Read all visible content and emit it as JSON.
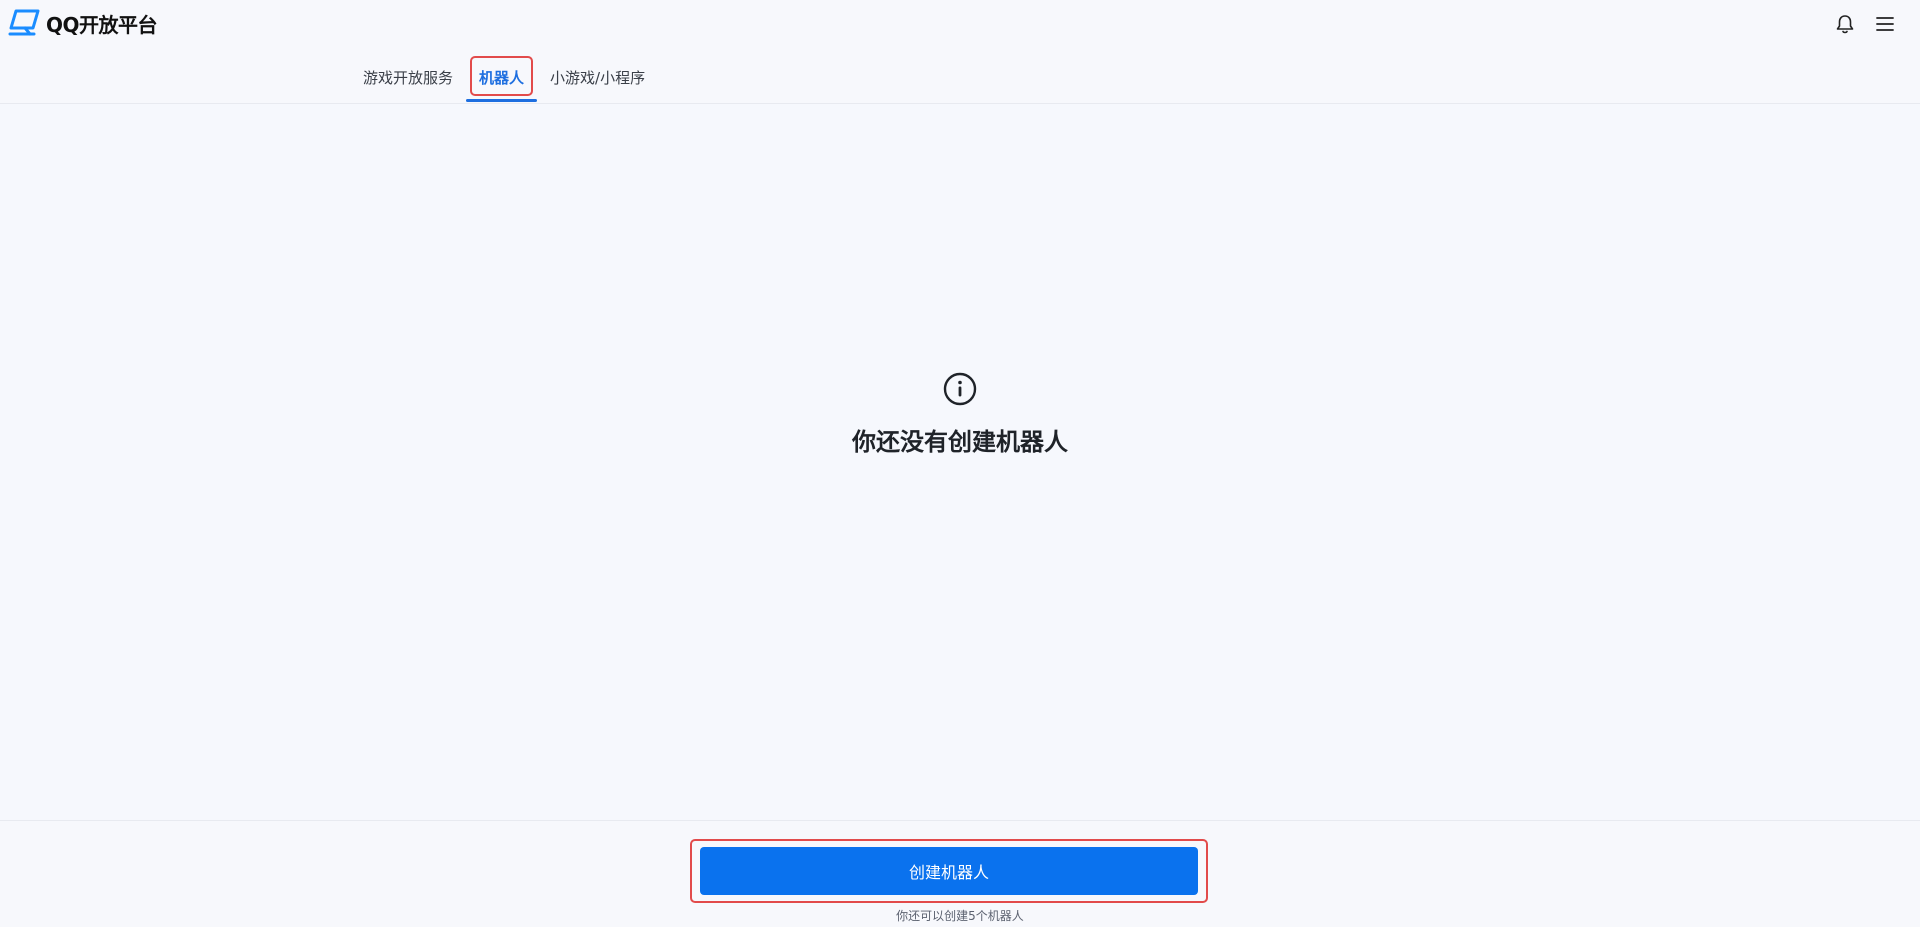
{
  "header": {
    "logo_text": "QQ开放平台",
    "notification_icon": "bell-icon",
    "menu_icon": "hamburger-menu-icon"
  },
  "tabs": [
    {
      "label": "游戏开放服务",
      "active": false
    },
    {
      "label": "机器人",
      "active": true
    },
    {
      "label": "小游戏/小程序",
      "active": false
    }
  ],
  "empty_state": {
    "icon": "info-circle-icon",
    "title": "你还没有创建机器人"
  },
  "footer": {
    "create_button_label": "创建机器人",
    "quota_text": "你还可以创建5个机器人"
  },
  "colors": {
    "accent": "#0a72ee",
    "highlight": "#e24b4b",
    "background": "#f6f8fd"
  }
}
